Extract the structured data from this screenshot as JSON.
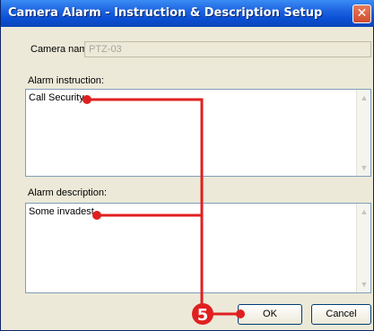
{
  "window": {
    "title": "Camera Alarm - Instruction & Description Setup",
    "close_label": "✕"
  },
  "form": {
    "camera_name_label": "Camera name:",
    "camera_name_value": "PTZ-03",
    "alarm_instruction_label": "Alarm instruction:",
    "alarm_instruction_value": "Call Security",
    "alarm_description_label": "Alarm description:",
    "alarm_description_value": "Some invadest"
  },
  "buttons": {
    "ok_label": "OK",
    "cancel_label": "Cancel"
  },
  "annotation": {
    "step_number": "5",
    "color": "#e02020"
  },
  "icons": {
    "scroll_up": "scroll-up-icon",
    "scroll_down": "scroll-down-icon"
  }
}
